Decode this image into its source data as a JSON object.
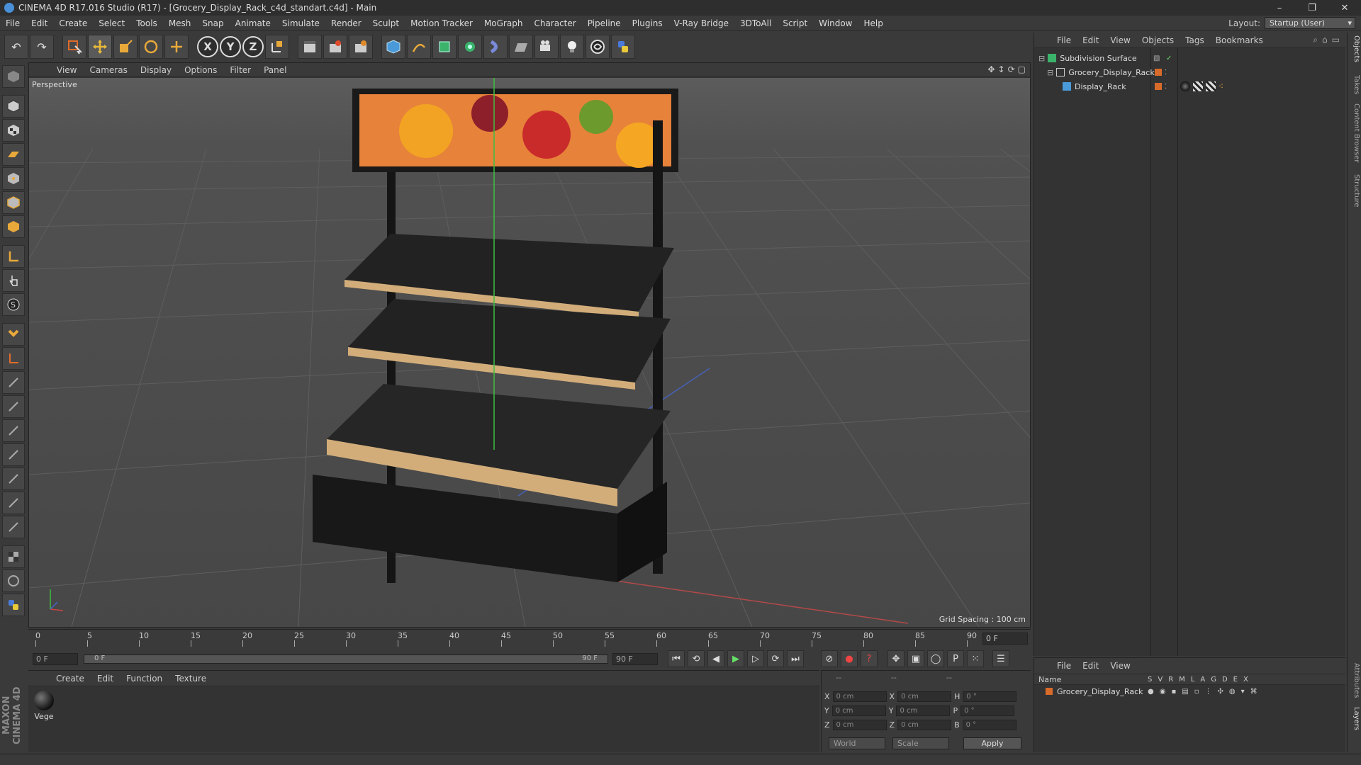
{
  "window": {
    "title": "CINEMA 4D R17.016 Studio (R17) - [Grocery_Display_Rack_c4d_standart.c4d] - Main",
    "minimize": "–",
    "restore": "❐",
    "close": "✕"
  },
  "menu": [
    "File",
    "Edit",
    "Create",
    "Select",
    "Tools",
    "Mesh",
    "Snap",
    "Animate",
    "Simulate",
    "Render",
    "Sculpt",
    "Motion Tracker",
    "MoGraph",
    "Character",
    "Pipeline",
    "Plugins",
    "V-Ray Bridge",
    "3DToAll",
    "Script",
    "Window",
    "Help"
  ],
  "layout": {
    "label": "Layout:",
    "value": "Startup (User)"
  },
  "toolbar": {
    "undo": "↶",
    "redo": "↷",
    "axis_x": "X",
    "axis_y": "Y",
    "axis_z": "Z"
  },
  "viewport": {
    "menu": [
      "View",
      "Cameras",
      "Display",
      "Options",
      "Filter",
      "Panel"
    ],
    "camera": "Perspective",
    "grid_spacing": "Grid Spacing : 100 cm"
  },
  "timeline": {
    "ticks": [
      "0",
      "5",
      "10",
      "15",
      "20",
      "25",
      "30",
      "35",
      "40",
      "45",
      "50",
      "55",
      "60",
      "65",
      "70",
      "75",
      "80",
      "85",
      "90"
    ],
    "current": "0 F"
  },
  "transport": {
    "start": "0 F",
    "slider_start": "0 F",
    "slider_end": "90 F",
    "end": "90 F"
  },
  "materials": {
    "menu": [
      "Create",
      "Edit",
      "Function",
      "Texture"
    ],
    "items": [
      {
        "name": "Vege"
      }
    ]
  },
  "coordinates": {
    "header": [
      "--",
      "--",
      "--"
    ],
    "rows": [
      {
        "axis": "X",
        "pos": "0 cm",
        "axis2": "X",
        "size": "0 cm",
        "rot_axis": "H",
        "rot": "0 °"
      },
      {
        "axis": "Y",
        "pos": "0 cm",
        "axis2": "Y",
        "size": "0 cm",
        "rot_axis": "P",
        "rot": "0 °"
      },
      {
        "axis": "Z",
        "pos": "0 cm",
        "axis2": "Z",
        "size": "0 cm",
        "rot_axis": "B",
        "rot": "0 °"
      }
    ],
    "mode": "World",
    "size_mode": "Scale",
    "apply": "Apply"
  },
  "objects": {
    "menu": [
      "File",
      "Edit",
      "View",
      "Objects",
      "Tags",
      "Bookmarks"
    ],
    "tree": [
      {
        "name": "Subdivision Surface",
        "level": 0
      },
      {
        "name": "Grocery_Display_Rack",
        "level": 1
      },
      {
        "name": "Display_Rack",
        "level": 2
      }
    ]
  },
  "layers": {
    "menu": [
      "File",
      "Edit",
      "View"
    ],
    "header": "Name",
    "columns": [
      "S",
      "V",
      "R",
      "M",
      "L",
      "A",
      "G",
      "D",
      "E",
      "X"
    ],
    "rows": [
      {
        "name": "Grocery_Display_Rack"
      }
    ]
  },
  "side_tabs": [
    "Objects",
    "Takes",
    "Content Browser",
    "Structure",
    "Attributes",
    "Layers"
  ],
  "brand": "MAXON CINEMA 4D",
  "colors": {
    "layer_orange": "#d86a2a",
    "accent_blue": "#4a90d9"
  }
}
